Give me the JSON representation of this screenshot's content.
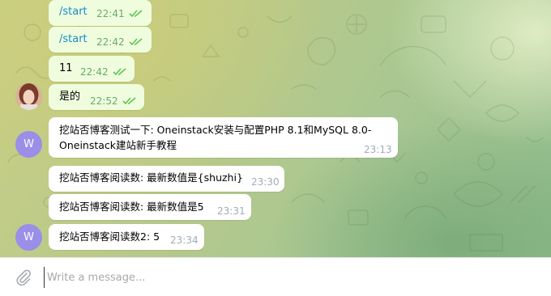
{
  "chat": {
    "messages": [
      {
        "text": "/start",
        "time": "22:41",
        "direction": "out",
        "status": "read",
        "style": "link"
      },
      {
        "text": "/start",
        "time": "22:42",
        "direction": "out",
        "status": "read",
        "style": "link"
      },
      {
        "text": "11",
        "time": "22:42",
        "direction": "out",
        "status": "read"
      },
      {
        "text": "是的",
        "time": "22:52",
        "direction": "out",
        "status": "read",
        "avatar": "user-photo"
      },
      {
        "text_line1": "挖站否博客测试一下: Oneinstack安装与配置PHP 8.1和MySQL 8.0-",
        "text_line2": "Oneinstack建站新手教程",
        "time": "23:13",
        "direction": "in",
        "avatar_letter": "W"
      },
      {
        "text": "挖站否博客阅读数: 最新数值是{shuzhi}",
        "time": "23:30",
        "direction": "in"
      },
      {
        "text": "挖站否博客阅读数: 最新数值是5",
        "time": "23:31",
        "direction": "in"
      },
      {
        "text": "挖站否博客阅读数2: 5",
        "time": "23:34",
        "direction": "in",
        "avatar_letter": "W"
      }
    ]
  },
  "input": {
    "placeholder": "Write a message..."
  },
  "colors": {
    "outgoing_bubble": "#effdde",
    "incoming_bubble": "#ffffff",
    "link": "#168acd",
    "read_ticks": "#5dc452",
    "avatar_w": "#9b8ee8"
  }
}
